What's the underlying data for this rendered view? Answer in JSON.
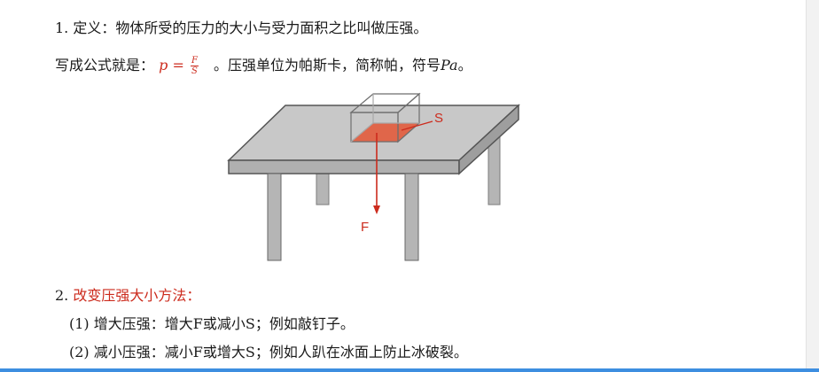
{
  "definition": {
    "number": "1.",
    "text": "定义：物体所受的压力的大小与受力面积之比叫做压强。"
  },
  "formula": {
    "intro": "写成公式就是：",
    "lhs": "p =",
    "numerator": "F",
    "denominator": "S",
    "after": "。压强单位为帕斯卡，简称帕，符号",
    "symbol": "Pa",
    "end": "。"
  },
  "diagram": {
    "area_label": "S",
    "force_label": "F",
    "colors": {
      "area": "#e0664a",
      "arrow": "#cc2b1d",
      "table": "#c8c8c8"
    }
  },
  "methods": {
    "number": "2.",
    "title": "改变压强大小方法：",
    "items": [
      {
        "num": "(1)",
        "text": "增大压强：增大F或减小S；例如敲钉子。"
      },
      {
        "num": "(2)",
        "text": "减小压强：减小F或增大S；例如人趴在冰面上防止冰破裂。"
      }
    ]
  }
}
